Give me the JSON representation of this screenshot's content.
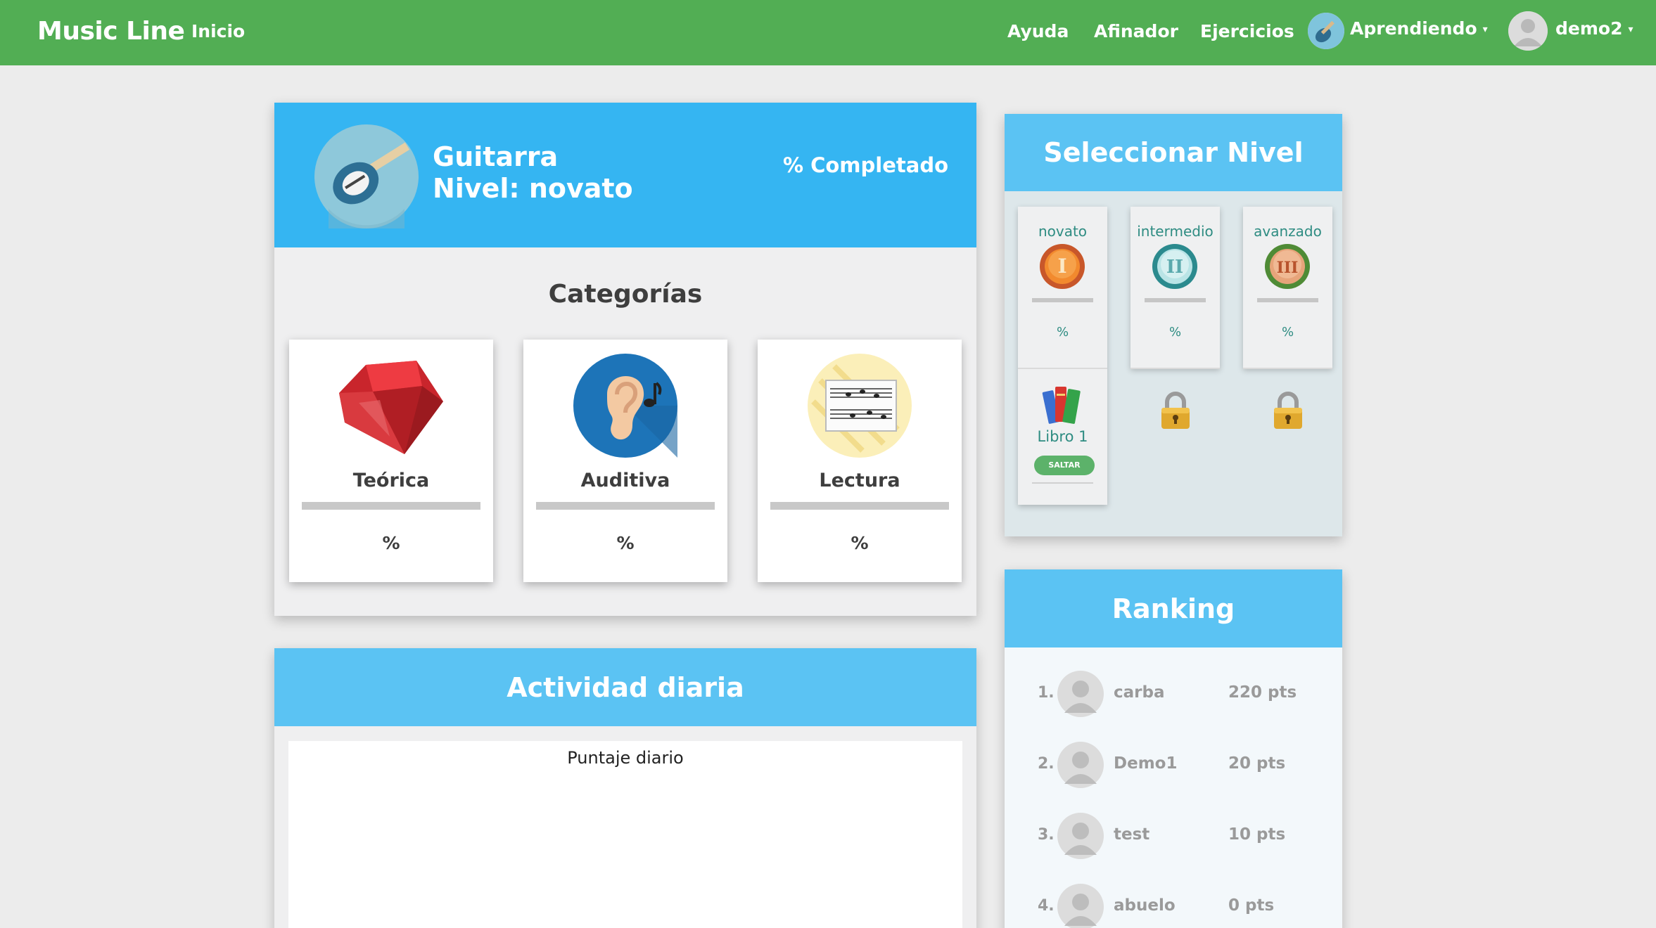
{
  "navbar": {
    "brand": "Music Line",
    "home": "Inicio",
    "help": "Ayuda",
    "tuner": "Afinador",
    "exercises": "Ejercicios",
    "learning": "Aprendiendo",
    "user": "demo2"
  },
  "profile": {
    "instrument": "Guitarra",
    "level": "Nivel: novato",
    "completed": "% Completado"
  },
  "categories": {
    "title": "Categorías",
    "items": [
      {
        "label": "Teórica",
        "pct": "%",
        "icon": "ruby-gem-icon"
      },
      {
        "label": "Auditiva",
        "pct": "%",
        "icon": "ear-music-icon"
      },
      {
        "label": "Lectura",
        "pct": "%",
        "icon": "sheet-music-icon"
      }
    ]
  },
  "activity": {
    "title": "Actividad diaria",
    "chart_title": "Puntaje diario"
  },
  "levels": {
    "title": "Seleccionar Nivel",
    "items": [
      {
        "name": "novato",
        "pct": "%",
        "medal": "I",
        "book": "Libro 1",
        "skip": "SALTAR"
      },
      {
        "name": "intermedio",
        "pct": "%",
        "medal": "II"
      },
      {
        "name": "avanzado",
        "pct": "%",
        "medal": "III"
      }
    ]
  },
  "ranking": {
    "title": "Ranking",
    "items": [
      {
        "pos": "1.",
        "name": "carba",
        "pts": "220 pts"
      },
      {
        "pos": "2.",
        "name": "Demo1",
        "pts": "20 pts"
      },
      {
        "pos": "3.",
        "name": "test",
        "pts": "10 pts"
      },
      {
        "pos": "4.",
        "name": "abuelo",
        "pts": "0 pts"
      }
    ]
  },
  "colors": {
    "navbar": "#52ae54",
    "header_blue": "#35b5f2",
    "card_blue": "#5bc3f3",
    "level_text": "#2e8c82"
  }
}
